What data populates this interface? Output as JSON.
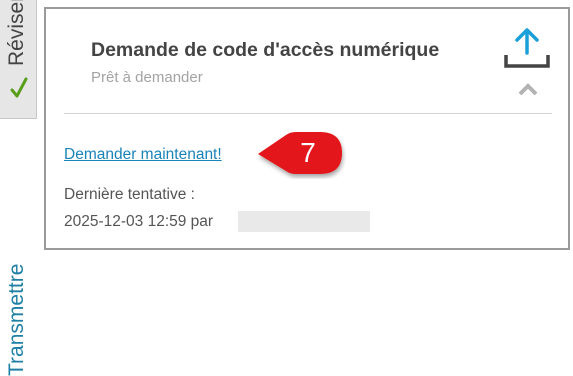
{
  "tabs": {
    "reviser": {
      "label": "Réviser",
      "icon": "checkmark-icon",
      "icon_color": "#5a9e1e"
    },
    "transmettre": {
      "label": "Transmettre",
      "color": "#1f7fa5"
    }
  },
  "card": {
    "title": "Demande de code d'accès numérique",
    "subtitle": "Prêt à demander",
    "upload_icon": "upload-icon",
    "upload_icon_color": "#1a9fd8",
    "collapse_icon": "chevron-up-icon",
    "request_link": "Demander maintenant!",
    "callout_number": "7",
    "callout_color": "#e3171a",
    "last_attempt_label": "Dernière tentative :",
    "last_attempt_value": "2025-12-03 12:59 par"
  }
}
